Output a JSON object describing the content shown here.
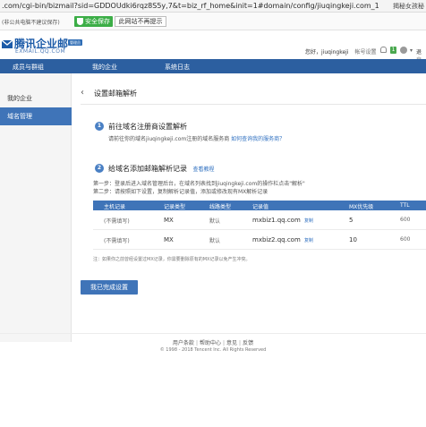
{
  "browser": {
    "url": ".com/cgi-bin/bizmail?sid=GDDOUdki6rqz8S5y,7&t=biz_rf_home&init=1#domain/config/jiuqingkeji.com_1",
    "right_text": "揭秘女孩秘"
  },
  "security_bar": {
    "notice": "(非公共电脑不建议保存)",
    "safe_button": "安全保存",
    "no_prompt_button": "此网站不再提示"
  },
  "brand": {
    "title": "腾讯企业邮",
    "subtitle": "EXMAIL.QQ.COM",
    "badge": "管理员"
  },
  "user": {
    "greeting": "您好，jiuqingkeji",
    "account_settings": "帐号设置",
    "message_count": "1",
    "exit": "退出"
  },
  "nav": {
    "items": [
      "成员与群组",
      "我的企业",
      "系统日志"
    ]
  },
  "sidebar": {
    "items": [
      {
        "label": "我的企业",
        "active": false
      },
      {
        "label": "域名管理",
        "active": true
      }
    ]
  },
  "page": {
    "title": "设置邮箱解析"
  },
  "step1": {
    "number": "1",
    "title": "前往域名注册商设置解析",
    "desc": "请前往你的域名jiuqingkeji.com注册的域名服务商",
    "desc_link": "如何查询我的服务商？"
  },
  "step2": {
    "number": "2",
    "title": "给域名添加邮箱解析记录",
    "title_link": "查看教程",
    "line1": "第一步：登录后进入域名管理后台，在域名列表找到jiuqingkeji.com的操作栏点击\"解析\"",
    "line2": "第二步：请按照如下设置，复制解析记录值，添加或修改现有MX解析记录"
  },
  "table": {
    "headers": [
      "主机记录",
      "记录类型",
      "线路类型",
      "记录值",
      "MX优先级",
      "TTL"
    ],
    "copy_label": "复制",
    "rows": [
      {
        "host": "(不需填写)",
        "type": "MX",
        "line": "默认",
        "value": "mxbiz1.qq.com",
        "priority": "5",
        "ttl": "600"
      },
      {
        "host": "(不需填写)",
        "type": "MX",
        "line": "默认",
        "value": "mxbiz2.qq.com",
        "priority": "10",
        "ttl": "600"
      }
    ]
  },
  "note": "注：如果你之前曾经设置过MX记录，你需要删除原有的MX记录以免产生冲突。",
  "done_button": "我已完成设置",
  "footer": {
    "links": [
      "用户条款",
      "帮助中心",
      "意见",
      "反馈"
    ],
    "copyright": "© 1998 - 2018 Tencent Inc. All Rights Reserved"
  },
  "colors": {
    "nav_blue": "#2c5fa0",
    "accent_blue": "#3f74b8",
    "safe_green": "#3cae47"
  }
}
